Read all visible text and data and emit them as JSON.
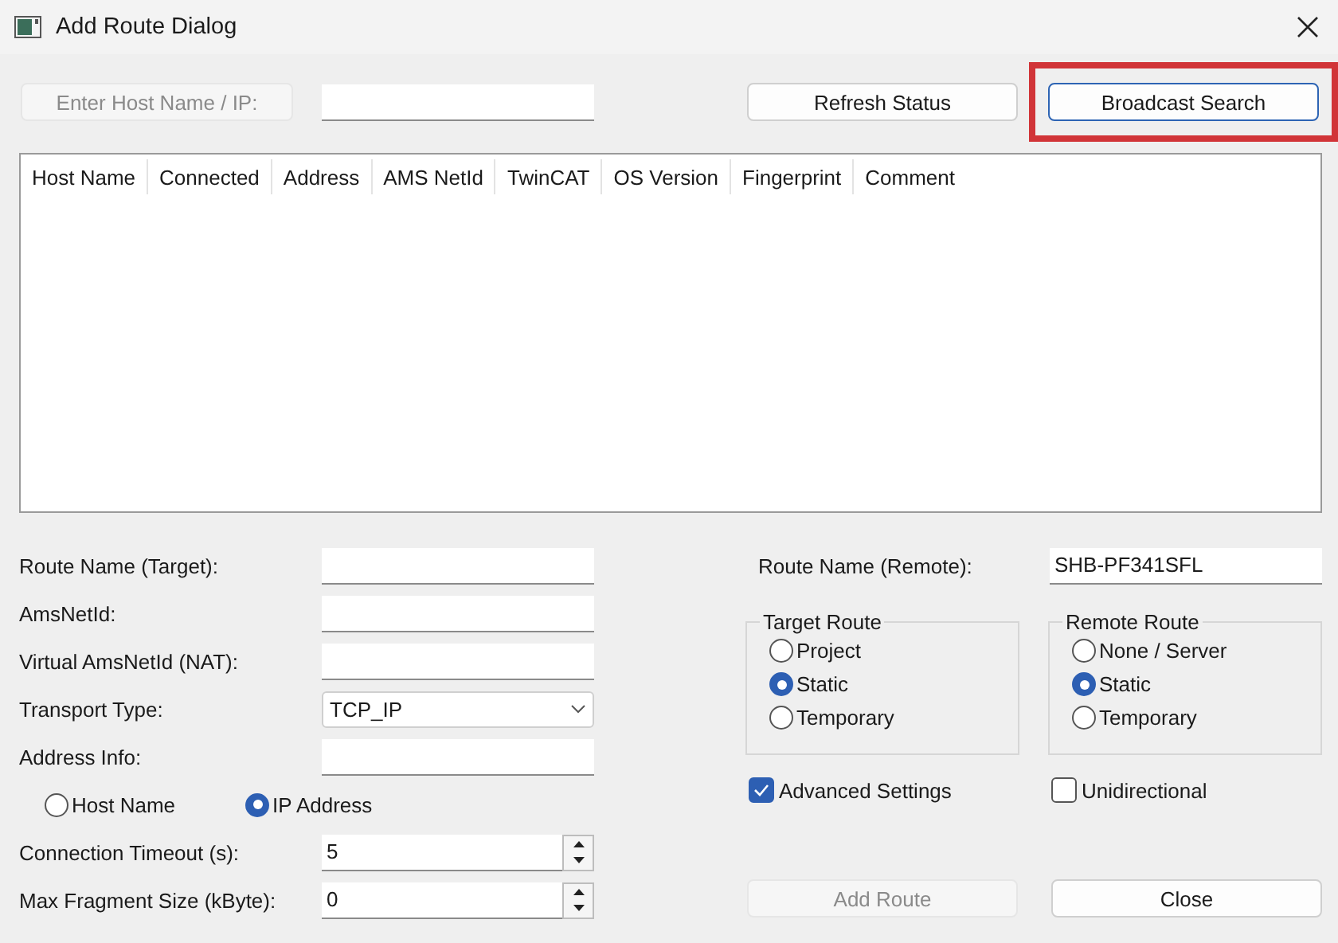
{
  "window": {
    "title": "Add Route Dialog"
  },
  "host_entry": {
    "label": "Enter Host Name / IP:",
    "disabled": true
  },
  "top_buttons": [
    {
      "label": "Refresh Status",
      "disabled": false,
      "focused": false,
      "highlighted": false
    },
    {
      "label": "Broadcast Search",
      "disabled": false,
      "focused": true,
      "highlighted": true
    }
  ],
  "table": {
    "columns": [
      "Host Name",
      "Connected",
      "Address",
      "AMS NetId",
      "TwinCAT",
      "OS Version",
      "Fingerprint",
      "Comment"
    ]
  },
  "left_fields": [
    {
      "kind": "text",
      "label": "Route Name (Target):"
    },
    {
      "kind": "text",
      "label": "AmsNetId:"
    },
    {
      "kind": "text",
      "label": "Virtual AmsNetId (NAT):"
    },
    {
      "kind": "select",
      "label": "Transport Type:",
      "value": "TCP_IP"
    },
    {
      "kind": "text",
      "label": "Address Info:"
    },
    {
      "kind": "radios",
      "options": [
        {
          "label": "Host Name",
          "selected": false
        },
        {
          "label": "IP Address",
          "selected": true
        }
      ]
    },
    {
      "kind": "spin",
      "label": "Connection Timeout (s):",
      "value": "5"
    },
    {
      "kind": "spin",
      "label": "Max Fragment Size (kByte):",
      "value": "0"
    }
  ],
  "remote_name": {
    "label": "Route Name (Remote):",
    "value": "SHB-PF341SFL"
  },
  "groups": [
    {
      "title": "Target Route",
      "options": [
        {
          "label": "Project",
          "selected": false
        },
        {
          "label": "Static",
          "selected": true
        },
        {
          "label": "Temporary",
          "selected": false
        }
      ]
    },
    {
      "title": "Remote Route",
      "options": [
        {
          "label": "None / Server",
          "selected": false
        },
        {
          "label": "Static",
          "selected": true
        },
        {
          "label": "Temporary",
          "selected": false
        }
      ]
    }
  ],
  "checkboxes": [
    {
      "label": "Advanced Settings",
      "checked": true
    },
    {
      "label": "Unidirectional",
      "checked": false
    }
  ],
  "bottom_buttons": [
    {
      "label": "Add Route",
      "disabled": true
    },
    {
      "label": "Close",
      "disabled": false
    }
  ]
}
